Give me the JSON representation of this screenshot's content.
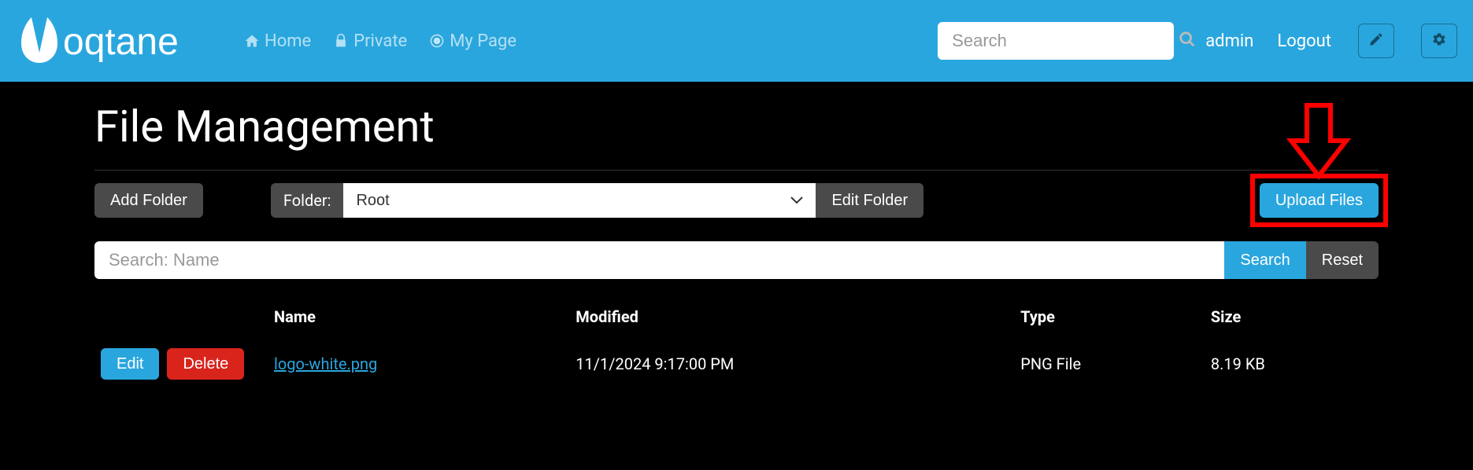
{
  "brand": "oqtane",
  "nav": {
    "items": [
      {
        "label": "Home",
        "icon": "home-icon"
      },
      {
        "label": "Private",
        "icon": "lock-icon"
      },
      {
        "label": "My Page",
        "icon": "target-icon"
      }
    ]
  },
  "search": {
    "placeholder": "Search"
  },
  "user": {
    "name": "admin",
    "logout": "Logout"
  },
  "page": {
    "title": "File Management"
  },
  "toolbar": {
    "add_folder": "Add Folder",
    "folder_label": "Folder:",
    "folder_selected": "Root",
    "edit_folder": "Edit Folder",
    "upload": "Upload Files"
  },
  "searchrow": {
    "placeholder": "Search: Name",
    "search": "Search",
    "reset": "Reset"
  },
  "table": {
    "headers": {
      "name": "Name",
      "modified": "Modified",
      "type": "Type",
      "size": "Size"
    },
    "row_actions": {
      "edit": "Edit",
      "delete": "Delete"
    },
    "rows": [
      {
        "name": "logo-white.png",
        "modified": "11/1/2024 9:17:00 PM",
        "type": "PNG File",
        "size": "8.19 KB"
      }
    ]
  },
  "annotation": {
    "highlight": "upload-files"
  }
}
